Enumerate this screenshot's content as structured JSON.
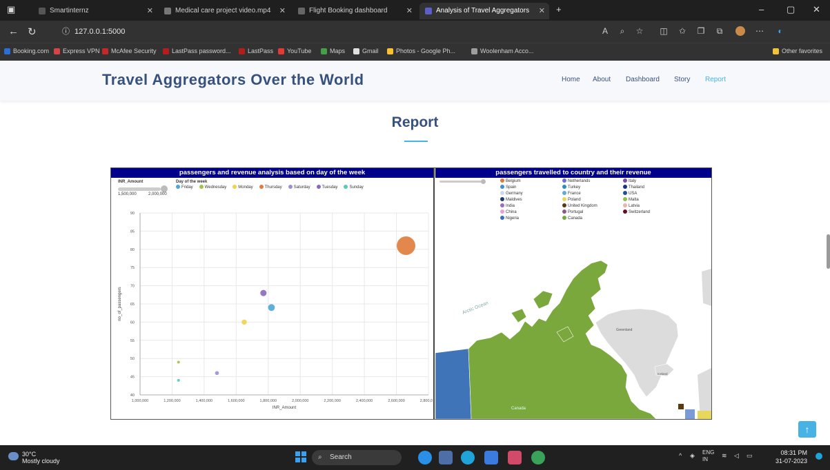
{
  "browser": {
    "tabs": [
      {
        "label": "Smartinternz",
        "color": "#555555"
      },
      {
        "label": "Medical care project video.mp4",
        "color": "#777777"
      },
      {
        "label": "Flight Booking dashboard",
        "color": "#666666"
      },
      {
        "label": "Analysis of Travel Aggregators",
        "color": "#5b5fc7"
      }
    ],
    "new_tab": "+",
    "url": "127.0.0.1:5000",
    "bookmarks": [
      {
        "label": "Booking.com",
        "color": "#2b6fd6"
      },
      {
        "label": "Express VPN",
        "color": "#d64545"
      },
      {
        "label": "McAfee Security",
        "color": "#c62828"
      },
      {
        "label": "LastPass password...",
        "color": "#b71c1c"
      },
      {
        "label": "LastPass",
        "color": "#b71c1c"
      },
      {
        "label": "YouTube",
        "color": "#e53935"
      },
      {
        "label": "Maps",
        "color": "#43a047"
      },
      {
        "label": "Gmail",
        "color": "#e0e0e0"
      },
      {
        "label": "Photos - Google Ph...",
        "color": "#fbc02d"
      },
      {
        "label": "Woolenham Acco...",
        "color": "#9e9e9e"
      }
    ],
    "other_favorites": "Other favorites"
  },
  "site": {
    "title": "Travel Aggregators Over the World",
    "nav": [
      "Home",
      "About",
      "Dashboard",
      "Story",
      "Report"
    ],
    "active_nav": "Report"
  },
  "report": {
    "heading": "Report"
  },
  "left_panel": {
    "title": "passengers and revenue analysis based on day of the week",
    "size_legend_title": "INR_Amount",
    "size_min": "1,500,000",
    "size_max": "2,000,000",
    "color_legend_title": "Day of the week",
    "days": [
      {
        "name": "Friday",
        "color": "#4aa7d6"
      },
      {
        "name": "Wednesday",
        "color": "#a3c04a"
      },
      {
        "name": "Monday",
        "color": "#f3d14a"
      },
      {
        "name": "Thursday",
        "color": "#e07b39"
      },
      {
        "name": "Saturday",
        "color": "#9b8fd6"
      },
      {
        "name": "Tuesday",
        "color": "#8b68c0"
      },
      {
        "name": "Sunday",
        "color": "#58c9b9"
      }
    ]
  },
  "chart_data": {
    "type": "scatter",
    "xlabel": "INR_Amount",
    "ylabel": "no_of_passengers",
    "xlim": [
      1000000,
      2800000
    ],
    "ylim": [
      40,
      90
    ],
    "xticks": [
      "1,000,000",
      "1,200,000",
      "1,400,000",
      "1,600,000",
      "1,800,000",
      "2,000,000",
      "2,200,000",
      "2,400,000",
      "2,600,000",
      "2,800,000"
    ],
    "yticks": [
      40,
      45,
      50,
      55,
      60,
      65,
      70,
      75,
      80,
      85,
      90
    ],
    "points": [
      {
        "day": "Thursday",
        "x": 2660000,
        "y": 81,
        "size": 2660000
      },
      {
        "day": "Tuesday",
        "x": 1770000,
        "y": 68,
        "size": 1770000
      },
      {
        "day": "Friday",
        "x": 1820000,
        "y": 64,
        "size": 1820000
      },
      {
        "day": "Monday",
        "x": 1650000,
        "y": 60,
        "size": 1650000
      },
      {
        "day": "Saturday",
        "x": 1480000,
        "y": 46,
        "size": 1480000
      },
      {
        "day": "Wednesday",
        "x": 1240000,
        "y": 49,
        "size": 1240000
      },
      {
        "day": "Sunday",
        "x": 1240000,
        "y": 44,
        "size": 1240000
      }
    ]
  },
  "right_panel": {
    "title": "passengers travelled to country and their revenue",
    "countries_col1": [
      {
        "name": "Belgium",
        "color": "#e07b39"
      },
      {
        "name": "Spain",
        "color": "#3f8fd1"
      },
      {
        "name": "Germany",
        "color": "#cfd8e6"
      },
      {
        "name": "Maldives",
        "color": "#1f3a6e"
      },
      {
        "name": "India",
        "color": "#9b6bc7"
      },
      {
        "name": "China",
        "color": "#e6a0d8"
      },
      {
        "name": "Nigeria",
        "color": "#3a6ec2"
      }
    ],
    "countries_col2": [
      {
        "name": "Netherlands",
        "color": "#6b6fd6"
      },
      {
        "name": "Turkey",
        "color": "#2a8fb8"
      },
      {
        "name": "France",
        "color": "#60a8e0"
      },
      {
        "name": "Poland",
        "color": "#e7d75a"
      },
      {
        "name": "United Kingdom",
        "color": "#5a3a10"
      },
      {
        "name": "Portugal",
        "color": "#8b5a8a"
      },
      {
        "name": "Canada",
        "color": "#7aa83c"
      }
    ],
    "countries_col3": [
      {
        "name": "Italy",
        "color": "#7b4db0"
      },
      {
        "name": "Thailand",
        "color": "#1f2f7a"
      },
      {
        "name": "USA",
        "color": "#1f4f9e"
      },
      {
        "name": "Malta",
        "color": "#8fc04a"
      },
      {
        "name": "Latvia",
        "color": "#f0b0b0"
      },
      {
        "name": "Switzerland",
        "color": "#6a0a20"
      }
    ],
    "map_labels": {
      "ocean": "Arctic Ocean",
      "greenland": "Greenland",
      "canada": "Canada",
      "iceland": "Iceland"
    }
  },
  "scroll_top_icon": "arrow-up-icon",
  "taskbar": {
    "temperature": "30°C",
    "weather": "Mostly cloudy",
    "search": "Search",
    "lang": "ENG",
    "region": "IN",
    "time": "08:31 PM",
    "date": "31-07-2023"
  }
}
